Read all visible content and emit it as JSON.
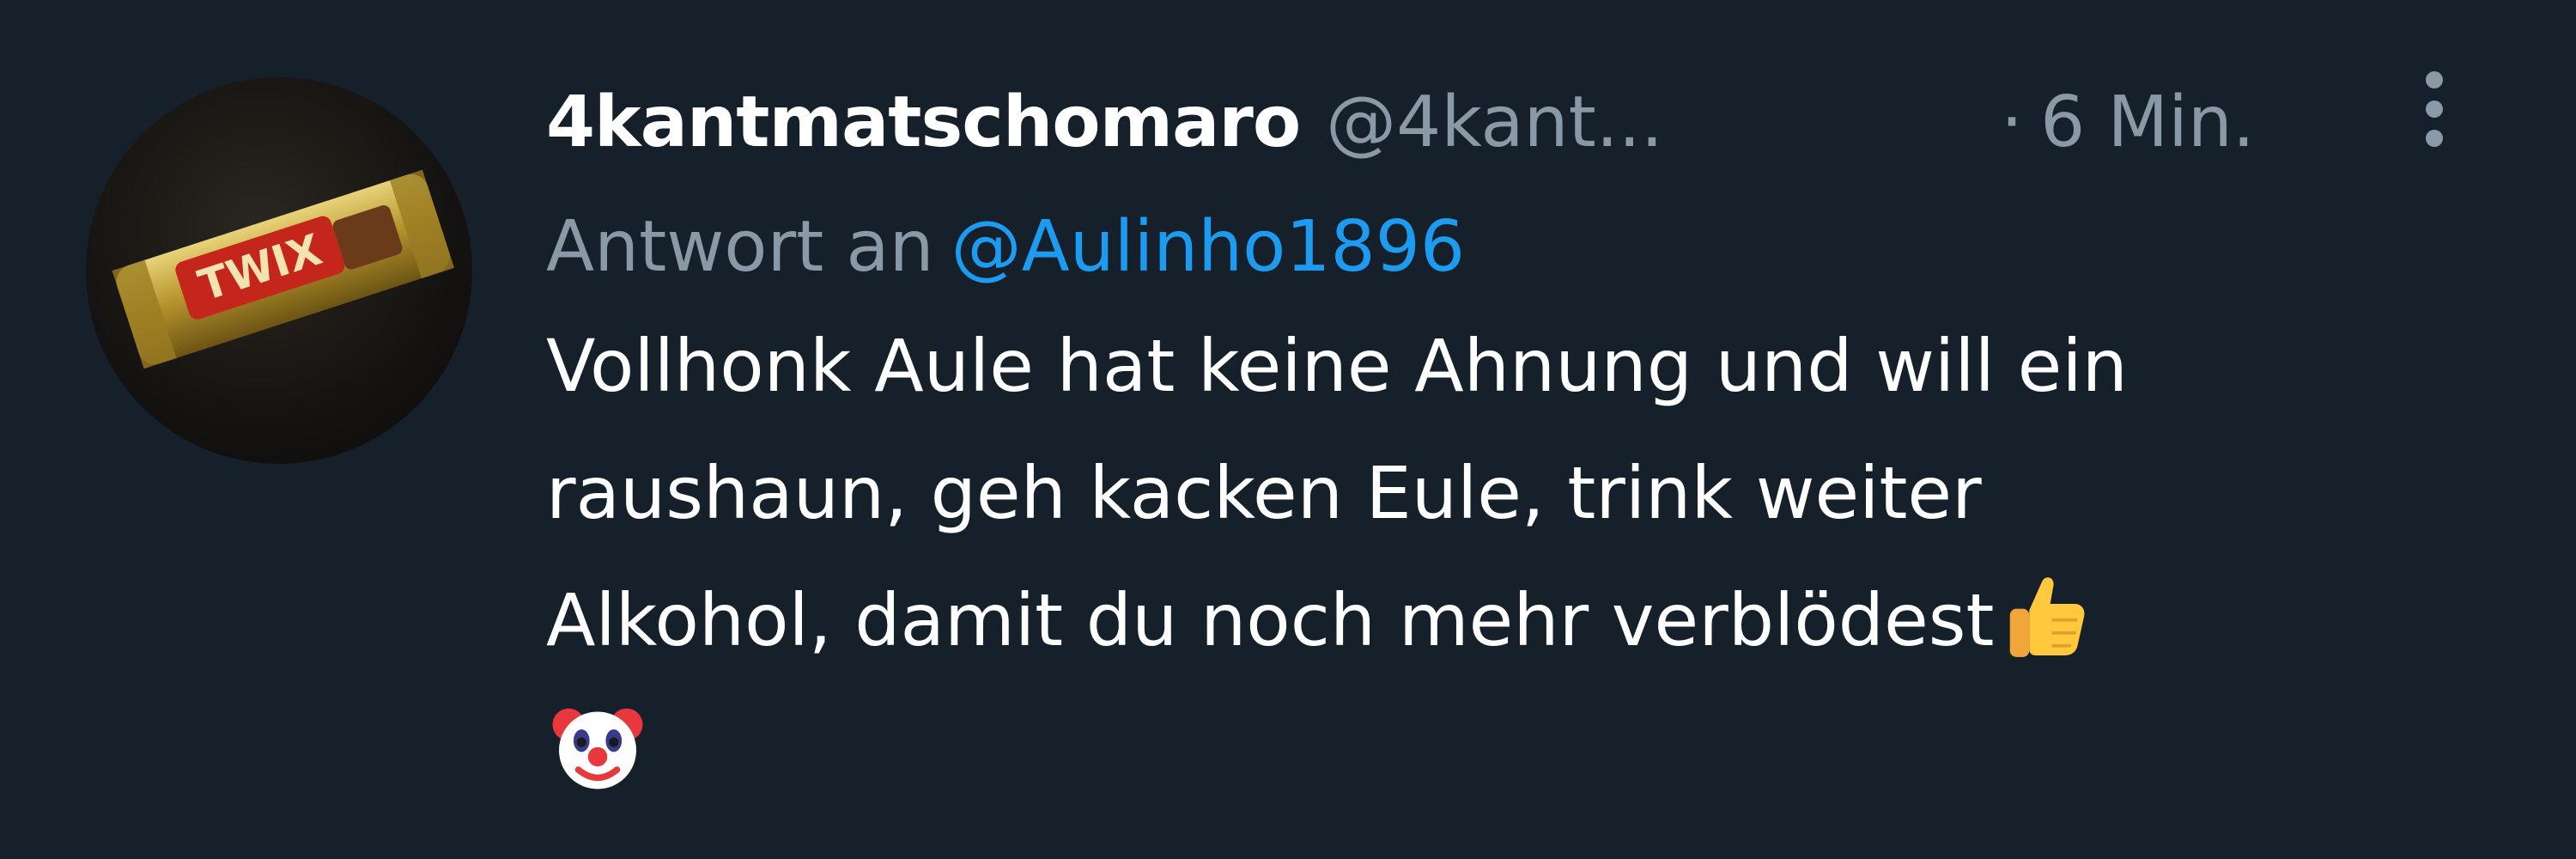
{
  "author": {
    "display_name": "4kantmatschomaro",
    "handle": "@4kant...",
    "avatar_label": "TWIX"
  },
  "meta": {
    "separator": "·",
    "time": "6 Min."
  },
  "reply": {
    "prefix": "Antwort an",
    "mention": "@Aulinho1896"
  },
  "body": {
    "line1": "Vollhonk Aule hat keine Ahnung und will ein",
    "line2": "raushaun, geh kacken Eule, trink weiter",
    "line3": "Alkohol, damit du noch mehr verblödest",
    "emoji1": "thumbs-up",
    "emoji2": "clown-face"
  },
  "colors": {
    "background": "#15202b",
    "text": "#ffffff",
    "secondary": "#8b98a5",
    "accent": "#1d9bf0"
  }
}
